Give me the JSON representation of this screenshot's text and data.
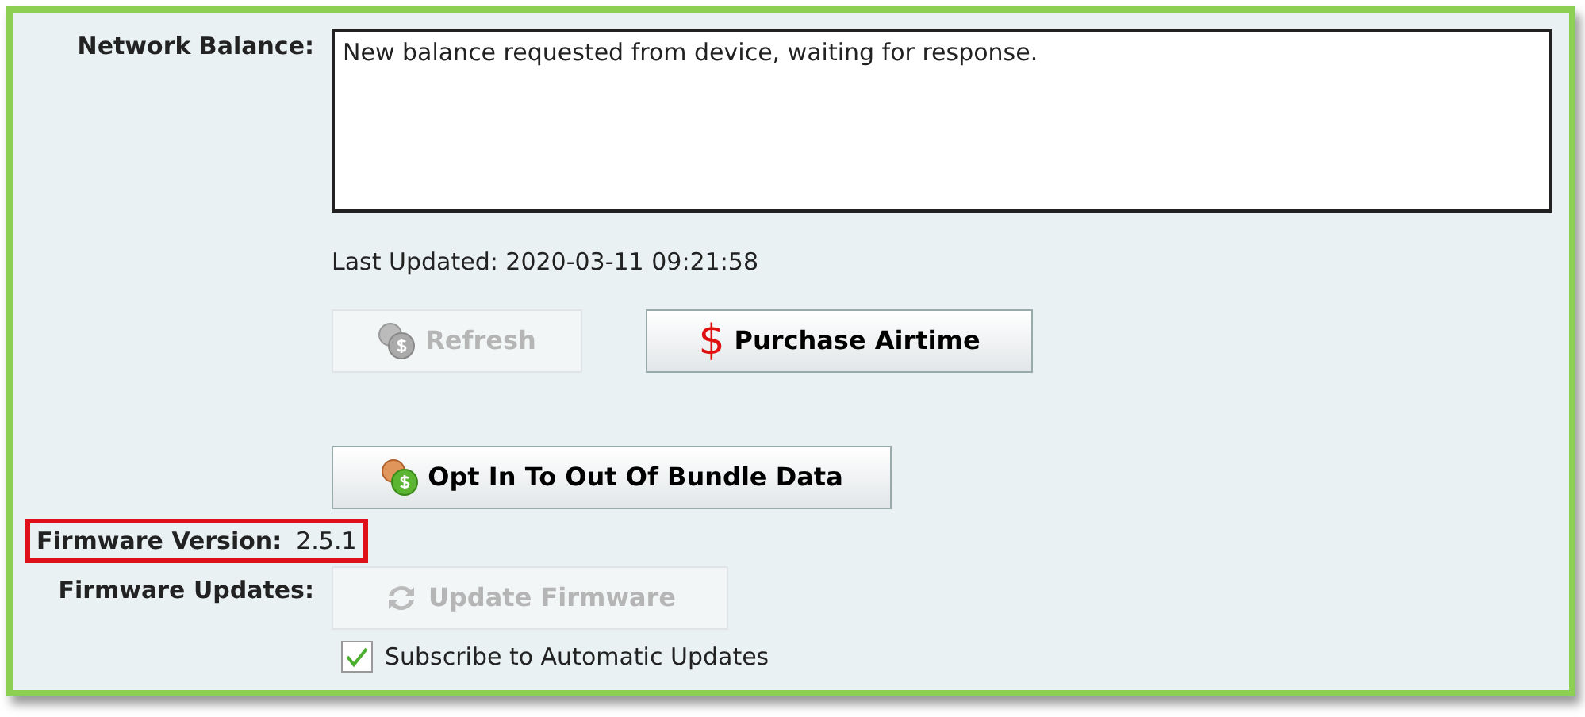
{
  "network_balance": {
    "label": "Network Balance:",
    "value": "New balance requested from device, waiting for response."
  },
  "last_updated": "Last Updated: 2020-03-11 09:21:58",
  "balance_buttons": [
    {
      "kind": "coins",
      "label": "Refresh",
      "disabled": true
    },
    {
      "kind": "dollar",
      "icon_text": "$",
      "label": "Purchase Airtime",
      "disabled": false
    }
  ],
  "bundle_button": {
    "kind": "coins",
    "label": "Opt In To Out Of Bundle Data",
    "disabled": false
  },
  "firmware_version": {
    "label": "Firmware Version:",
    "value": "2.5.1",
    "highlighted": true
  },
  "firmware_updates": {
    "label": "Firmware Updates:",
    "button": {
      "kind": "refresh",
      "label": "Update Firmware",
      "disabled": true
    }
  },
  "auto_updates": {
    "label": "Subscribe to Automatic Updates",
    "checked": true
  }
}
